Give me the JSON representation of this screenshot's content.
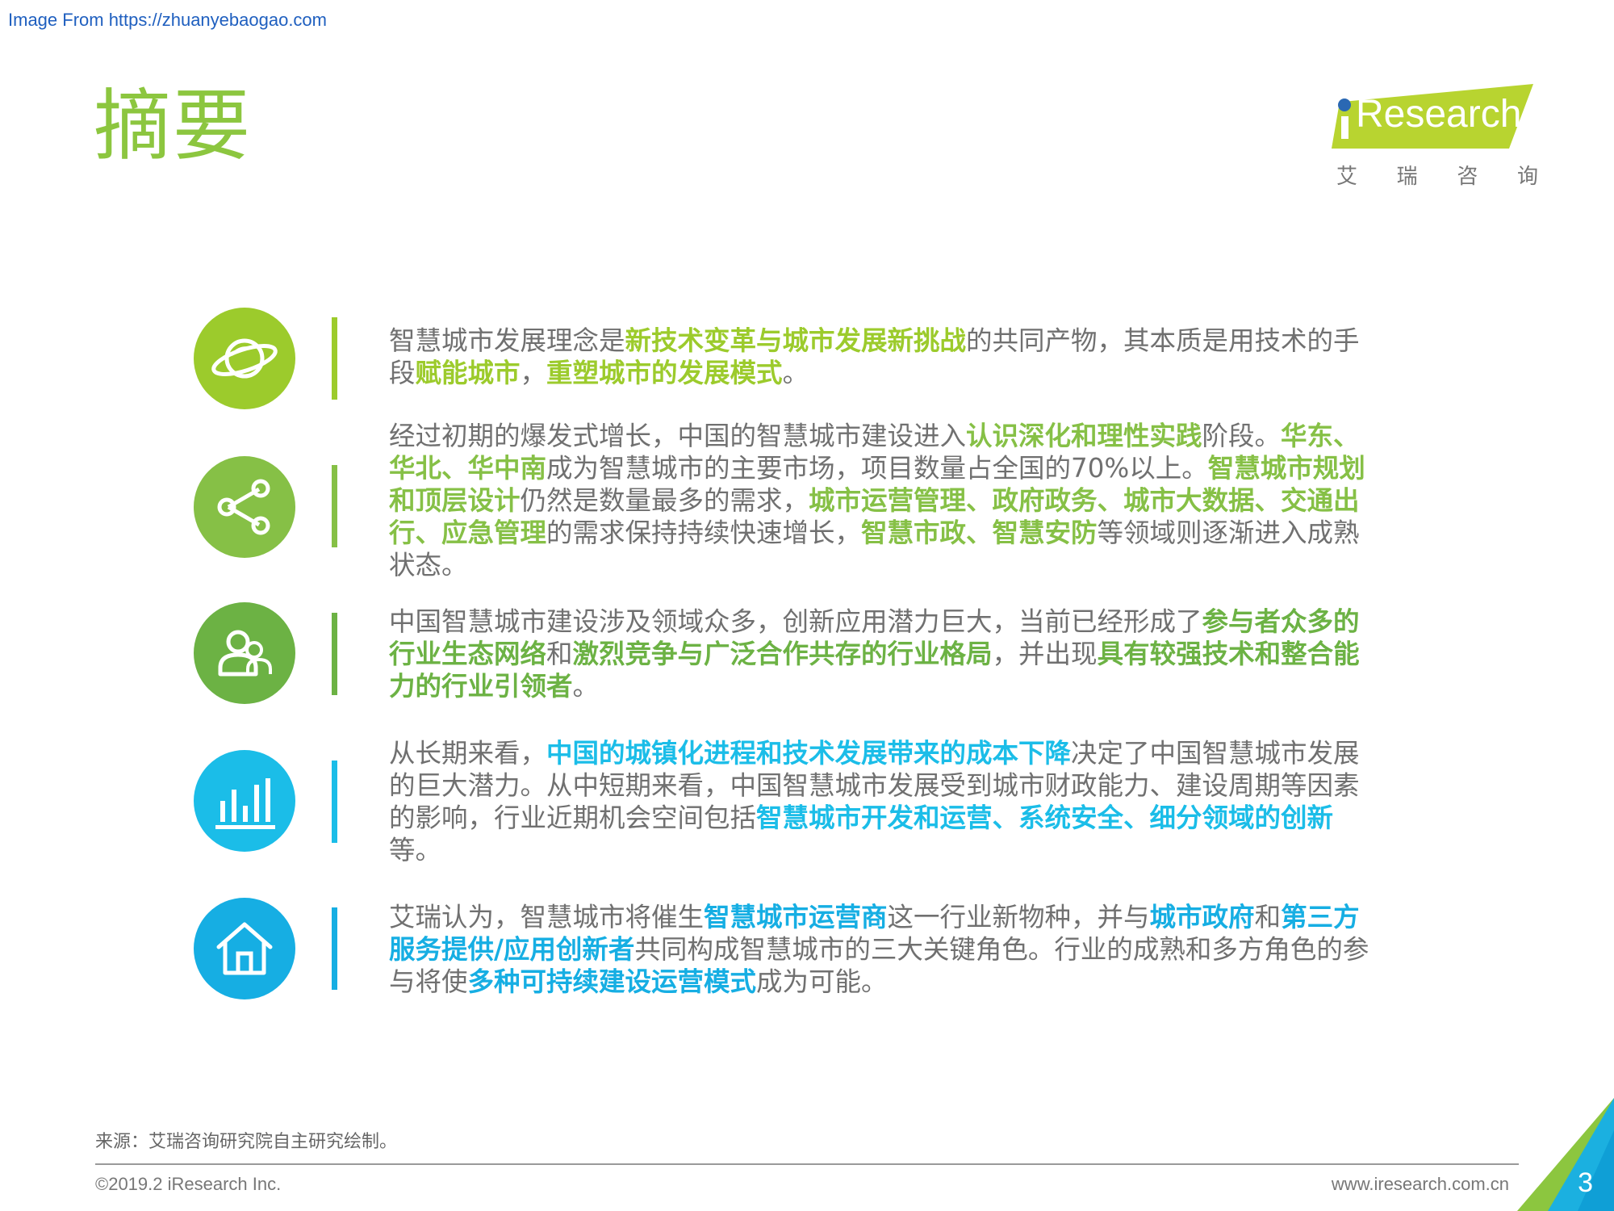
{
  "watermark": "Image From https://zhuanyebaogao.com",
  "title": "摘要",
  "logo": {
    "text": "Research",
    "cn": [
      "艾",
      "瑞",
      "咨",
      "询"
    ]
  },
  "colors": {
    "title": "#8cc63f",
    "lime": "#9ccb2c",
    "green": "#86c046",
    "darkgreen": "#6cb244",
    "cyan": "#1bbde8",
    "blue": "#16aee3",
    "text": "#707070"
  },
  "items": [
    {
      "icon": "planet-icon",
      "color": "lime",
      "segments": [
        {
          "t": "智慧城市发展理念是"
        },
        {
          "t": "新技术变革与城市发展新挑战",
          "h": 1
        },
        {
          "t": "的共同产物，其本质是用技术的手段"
        },
        {
          "t": "赋能城市",
          "h": 1
        },
        {
          "t": "，"
        },
        {
          "t": "重塑城市的发展模式",
          "h": 1
        },
        {
          "t": "。"
        }
      ]
    },
    {
      "icon": "share-icon",
      "color": "green",
      "segments": [
        {
          "t": "经过初期的爆发式增长，中国的智慧城市建设进入"
        },
        {
          "t": "认识深化和理性实践",
          "h": 1
        },
        {
          "t": "阶段。"
        },
        {
          "t": "华东、华北、华中南",
          "h": 1
        },
        {
          "t": "成为智慧城市的主要市场，项目数量占全国的70%以上。"
        },
        {
          "t": "智慧城市规划和顶层设计",
          "h": 1
        },
        {
          "t": "仍然是数量最多的需求，"
        },
        {
          "t": "城市运营管理、政府政务、城市大数据、交通出行、应急管理",
          "h": 1
        },
        {
          "t": "的需求保持持续快速增长，"
        },
        {
          "t": "智慧市政、智慧安防",
          "h": 1
        },
        {
          "t": "等领域则逐渐进入成熟状态。"
        }
      ]
    },
    {
      "icon": "people-icon",
      "color": "darkgreen",
      "segments": [
        {
          "t": "中国智慧城市建设涉及领域众多，创新应用潜力巨大，当前已经形成了"
        },
        {
          "t": "参与者众多的行业生态网络",
          "h": 1
        },
        {
          "t": "和"
        },
        {
          "t": "激烈竞争与广泛合作共存的行业格局",
          "h": 1
        },
        {
          "t": "，并出现"
        },
        {
          "t": "具有较强技术和整合能力的行业引领者",
          "h": 1
        },
        {
          "t": "。"
        }
      ]
    },
    {
      "icon": "bar-chart-icon",
      "color": "cyan",
      "segments": [
        {
          "t": "从长期来看，"
        },
        {
          "t": "中国的城镇化进程和技术发展带来的成本下降",
          "h": 1
        },
        {
          "t": "决定了中国智慧城市发展的巨大潜力。从中短期来看，中国智慧城市发展受到城市财政能力、建设周期等因素的影响，行业近期机会空间包括"
        },
        {
          "t": "智慧城市开发和运营、系统安全、细分领域的创新",
          "h": 1
        },
        {
          "t": "等。"
        }
      ]
    },
    {
      "icon": "house-icon",
      "color": "blue",
      "segments": [
        {
          "t": "艾瑞认为，智慧城市将催生"
        },
        {
          "t": "智慧城市运营商",
          "h": 1
        },
        {
          "t": "这一行业新物种，并与"
        },
        {
          "t": "城市政府",
          "h": 1
        },
        {
          "t": "和"
        },
        {
          "t": "第三方服务提供/应用创新者",
          "h": 1
        },
        {
          "t": "共同构成智慧城市的三大关键角色。行业的成熟和多方角色的参与将使"
        },
        {
          "t": "多种可持续建设运营模式",
          "h": 1
        },
        {
          "t": "成为可能。"
        }
      ]
    }
  ],
  "footer": {
    "source": "来源：艾瑞咨询研究院自主研究绘制。",
    "copyright": "©2019.2 iResearch Inc.",
    "website": "www.iresearch.com.cn",
    "page_number": "3"
  }
}
